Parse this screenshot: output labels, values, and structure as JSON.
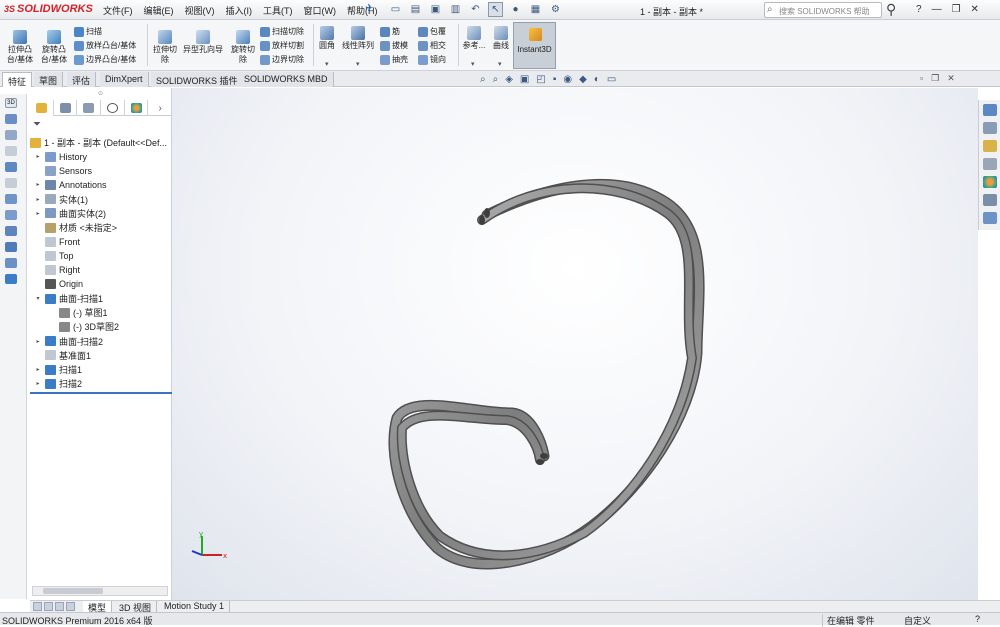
{
  "app": {
    "brand": "SOLIDWORKS",
    "brand_prefix": "3S",
    "document_title": "1 - 副本 - 副本 *"
  },
  "menus": [
    "文件(F)",
    "编辑(E)",
    "视图(V)",
    "插入(I)",
    "工具(T)",
    "窗口(W)",
    "帮助(H)"
  ],
  "search": {
    "placeholder": "搜索 SOLIDWORKS 帮助"
  },
  "ribbon": {
    "extrude_boss": "拉伸凸\n台/基体",
    "revolve_boss": "旋转凸\n台/基体",
    "sweep": "扫描",
    "loft_boss": "放样凸台/基体",
    "boundary_boss": "边界凸台/基体",
    "extrude_cut": "拉伸切\n除",
    "hole_wizard": "异型孔向导",
    "revolve_cut": "旋转切\n除",
    "sweep_cut": "扫描切除",
    "loft_cut": "放样切割",
    "boundary_cut": "边界切除",
    "fillet": "圆角",
    "linear_pattern": "线性阵列",
    "rib": "筋",
    "draft": "拔模",
    "shell": "抽壳",
    "wrap": "包覆",
    "intersect": "相交",
    "mirror": "镜向",
    "reference": "参考...",
    "curves": "曲线",
    "instant3d": "Instant3D"
  },
  "command_tabs": [
    "特征",
    "草图",
    "评估",
    "DimXpert",
    "SOLIDWORKS 插件",
    "SOLIDWORKS MBD"
  ],
  "tree": {
    "root": "1 - 副本 - 副本  (Default<<Def...",
    "items": [
      {
        "label": "History",
        "arrow": "▸",
        "indent": 0
      },
      {
        "label": "Sensors",
        "arrow": "",
        "indent": 0
      },
      {
        "label": "Annotations",
        "arrow": "▸",
        "indent": 0
      },
      {
        "label": "实体(1)",
        "arrow": "▸",
        "indent": 0
      },
      {
        "label": "曲面实体(2)",
        "arrow": "▸",
        "indent": 0
      },
      {
        "label": "材质 <未指定>",
        "arrow": "",
        "indent": 0
      },
      {
        "label": "Front",
        "arrow": "",
        "indent": 0
      },
      {
        "label": "Top",
        "arrow": "",
        "indent": 0
      },
      {
        "label": "Right",
        "arrow": "",
        "indent": 0
      },
      {
        "label": "Origin",
        "arrow": "",
        "indent": 0
      },
      {
        "label": "曲面-扫描1",
        "arrow": "▾",
        "indent": 0
      },
      {
        "label": "(-) 草图1",
        "arrow": "",
        "indent": 1
      },
      {
        "label": "(-) 3D草图2",
        "arrow": "",
        "indent": 1
      },
      {
        "label": "曲面-扫描2",
        "arrow": "▸",
        "indent": 0
      },
      {
        "label": "基准面1",
        "arrow": "",
        "indent": 0
      },
      {
        "label": "扫描1",
        "arrow": "▸",
        "indent": 0
      },
      {
        "label": "扫描2",
        "arrow": "▸",
        "indent": 0
      }
    ]
  },
  "bottom_tabs": [
    "模型",
    "3D 视图",
    "Motion Study 1"
  ],
  "status": {
    "product": "SOLIDWORKS Premium 2016 x64 版",
    "mode": "在编辑 零件",
    "units": "自定义",
    "help": "?"
  },
  "colors": {
    "accent": "#3b72c4",
    "brand": "#d2232a",
    "model": "#8e8e8e"
  }
}
